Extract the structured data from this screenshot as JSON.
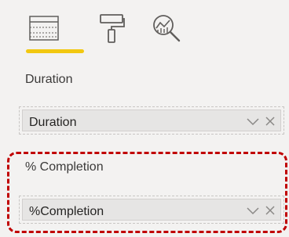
{
  "toolbar": {
    "tabs": [
      {
        "icon": "fields-grid-icon",
        "active": true
      },
      {
        "icon": "paint-roller-icon",
        "active": false
      },
      {
        "icon": "analytics-magnifier-icon",
        "active": false
      }
    ],
    "accent_color": "#f2c811"
  },
  "wells": [
    {
      "label": "Duration",
      "field": "Duration"
    },
    {
      "label": "% Completion",
      "field": "%Completion"
    }
  ],
  "colors": {
    "background": "#f3f2f1",
    "pill": "#e6e5e4",
    "highlight": "#c00000"
  }
}
